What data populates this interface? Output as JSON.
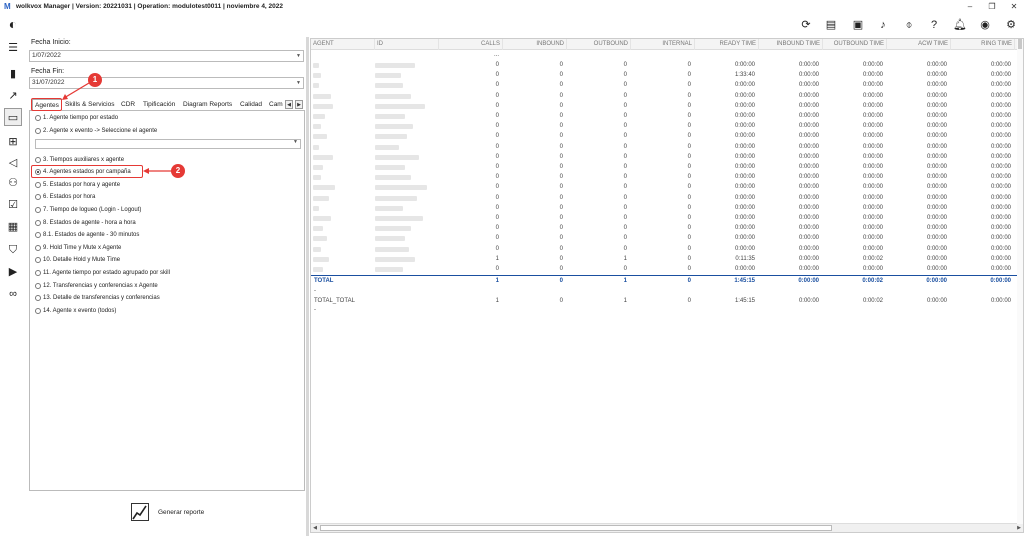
{
  "app": {
    "title": "wolkvox Manager  | Version: 20221031 |  Operation: modulotest0011  |  noviembre 4, 2022",
    "logo": "M"
  },
  "window_controls": [
    "–",
    "❐",
    "✕"
  ],
  "toolbar_icons": [
    "refresh-icon",
    "news-icon",
    "contact-card-icon",
    "music-note-icon",
    "microphone-icon",
    "help-icon",
    "bell-icon",
    "user-circle-icon",
    "gear-icon"
  ],
  "sidebar_icons": [
    "avatar-icon",
    "menu-icon",
    "bar-chart-icon",
    "trend-chart-icon",
    "document-icon",
    "flow-icon",
    "megaphone-icon",
    "users-icon",
    "checklist-icon",
    "table-icon",
    "shield-icon",
    "video-icon",
    "voicemail-icon"
  ],
  "filters": {
    "fecha_inicio_label": "Fecha Inicio:",
    "fecha_inicio_value": "1/07/2022",
    "fecha_fin_label": "Fecha Fin:",
    "fecha_fin_value": "31/07/2022"
  },
  "tabs": [
    "Agentes",
    "Skills & Servicios",
    "CDR",
    "Tipificación",
    "Diagram Reports",
    "Calidad",
    "Cam"
  ],
  "options": [
    "1. Agente tiempo por estado",
    "2. Agente x evento -> Seleccione el agente",
    "3. Tiempos auxiliares x agente",
    "4. Agentes estados por campaña",
    "5. Estados por hora y agente",
    "6. Estados por hora",
    "7. Tiempo de logueo (Login - Logout)",
    "8. Estados de agente - hora a hora",
    "8.1. Estados de agente - 30 minutos",
    "9. Hold Time y Mute x Agente",
    "10. Detalle Hold y Mute Time",
    "11. Agente tiempo por estado agrupado por skill",
    "12. Transferencias y conferencias x Agente",
    "13. Detalle de transferencias y conferencias",
    "14. Agente x evento (todos)"
  ],
  "selected_option": "4. Agentes estados por campaña",
  "generate_button": "Generar reporte",
  "annotations": {
    "badge1": "1",
    "badge2": "2"
  },
  "table": {
    "columns": [
      "AGENT",
      "ID",
      "CALLS",
      "INBOUND",
      "OUTBOUND",
      "INTERNAL",
      "READY TIME",
      "INBOUND TIME",
      "OUTBOUND TIME",
      "ACW TIME",
      "RING TIME"
    ],
    "first_row_partial": "...",
    "rows": [
      [
        "0",
        "0",
        "0",
        "0",
        "0:00:00",
        "0:00:00",
        "0:00:00",
        "0:00:00",
        "0:00:00"
      ],
      [
        "0",
        "0",
        "0",
        "0",
        "1:33:40",
        "0:00:00",
        "0:00:00",
        "0:00:00",
        "0:00:00"
      ],
      [
        "0",
        "0",
        "0",
        "0",
        "0:00:00",
        "0:00:00",
        "0:00:00",
        "0:00:00",
        "0:00:00"
      ],
      [
        "0",
        "0",
        "0",
        "0",
        "0:00:00",
        "0:00:00",
        "0:00:00",
        "0:00:00",
        "0:00:00"
      ],
      [
        "0",
        "0",
        "0",
        "0",
        "0:00:00",
        "0:00:00",
        "0:00:00",
        "0:00:00",
        "0:00:00"
      ],
      [
        "0",
        "0",
        "0",
        "0",
        "0:00:00",
        "0:00:00",
        "0:00:00",
        "0:00:00",
        "0:00:00"
      ],
      [
        "0",
        "0",
        "0",
        "0",
        "0:00:00",
        "0:00:00",
        "0:00:00",
        "0:00:00",
        "0:00:00"
      ],
      [
        "0",
        "0",
        "0",
        "0",
        "0:00:00",
        "0:00:00",
        "0:00:00",
        "0:00:00",
        "0:00:00"
      ],
      [
        "0",
        "0",
        "0",
        "0",
        "0:00:00",
        "0:00:00",
        "0:00:00",
        "0:00:00",
        "0:00:00"
      ],
      [
        "0",
        "0",
        "0",
        "0",
        "0:00:00",
        "0:00:00",
        "0:00:00",
        "0:00:00",
        "0:00:00"
      ],
      [
        "0",
        "0",
        "0",
        "0",
        "0:00:00",
        "0:00:00",
        "0:00:00",
        "0:00:00",
        "0:00:00"
      ],
      [
        "0",
        "0",
        "0",
        "0",
        "0:00:00",
        "0:00:00",
        "0:00:00",
        "0:00:00",
        "0:00:00"
      ],
      [
        "0",
        "0",
        "0",
        "0",
        "0:00:00",
        "0:00:00",
        "0:00:00",
        "0:00:00",
        "0:00:00"
      ],
      [
        "0",
        "0",
        "0",
        "0",
        "0:00:00",
        "0:00:00",
        "0:00:00",
        "0:00:00",
        "0:00:00"
      ],
      [
        "0",
        "0",
        "0",
        "0",
        "0:00:00",
        "0:00:00",
        "0:00:00",
        "0:00:00",
        "0:00:00"
      ],
      [
        "0",
        "0",
        "0",
        "0",
        "0:00:00",
        "0:00:00",
        "0:00:00",
        "0:00:00",
        "0:00:00"
      ],
      [
        "0",
        "0",
        "0",
        "0",
        "0:00:00",
        "0:00:00",
        "0:00:00",
        "0:00:00",
        "0:00:00"
      ],
      [
        "0",
        "0",
        "0",
        "0",
        "0:00:00",
        "0:00:00",
        "0:00:00",
        "0:00:00",
        "0:00:00"
      ],
      [
        "0",
        "0",
        "0",
        "0",
        "0:00:00",
        "0:00:00",
        "0:00:00",
        "0:00:00",
        "0:00:00"
      ],
      [
        "1",
        "0",
        "1",
        "0",
        "0:11:35",
        "0:00:00",
        "0:00:02",
        "0:00:00",
        "0:00:00"
      ],
      [
        "0",
        "0",
        "0",
        "0",
        "0:00:00",
        "0:00:00",
        "0:00:00",
        "0:00:00",
        "0:00:00"
      ]
    ],
    "total": [
      "TOTAL",
      "1",
      "0",
      "1",
      "0",
      "1:45:15",
      "0:00:00",
      "0:00:02",
      "0:00:00",
      "0:00:00"
    ],
    "sep1": "-",
    "total_total": [
      "TOTAL_TOTAL",
      "1",
      "0",
      "1",
      "0",
      "1:45:15",
      "0:00:00",
      "0:00:02",
      "0:00:00",
      "0:00:00"
    ],
    "sep2": "-"
  }
}
